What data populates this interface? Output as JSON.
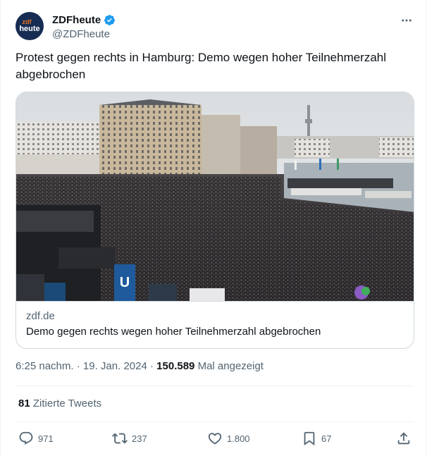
{
  "author": {
    "display_name": "ZDFheute",
    "handle": "@ZDFheute",
    "avatar_line1": "zdf",
    "avatar_line2": "heute"
  },
  "tweet": {
    "text": "Protest gegen rechts in Hamburg: Demo wegen hoher Teilnehmerzahl abgebrochen"
  },
  "link_card": {
    "domain": "zdf.de",
    "title": "Demo gegen rechts wegen hoher Teilnehmerzahl abgebrochen",
    "image_label": "U"
  },
  "meta": {
    "time": "6:25 nachm.",
    "separator": " · ",
    "date": "19. Jan. 2024",
    "views": "150.589",
    "views_label": "Mal angezeigt"
  },
  "quotes": {
    "count": "81",
    "label": "Zitierte Tweets"
  },
  "actions": {
    "replies": "971",
    "retweets": "237",
    "likes": "1.800",
    "bookmarks": "67"
  },
  "colors": {
    "verified": "#1d9bf0",
    "secondary_text": "#536471",
    "primary_text": "#0f1419",
    "border": "#cfd9de"
  }
}
